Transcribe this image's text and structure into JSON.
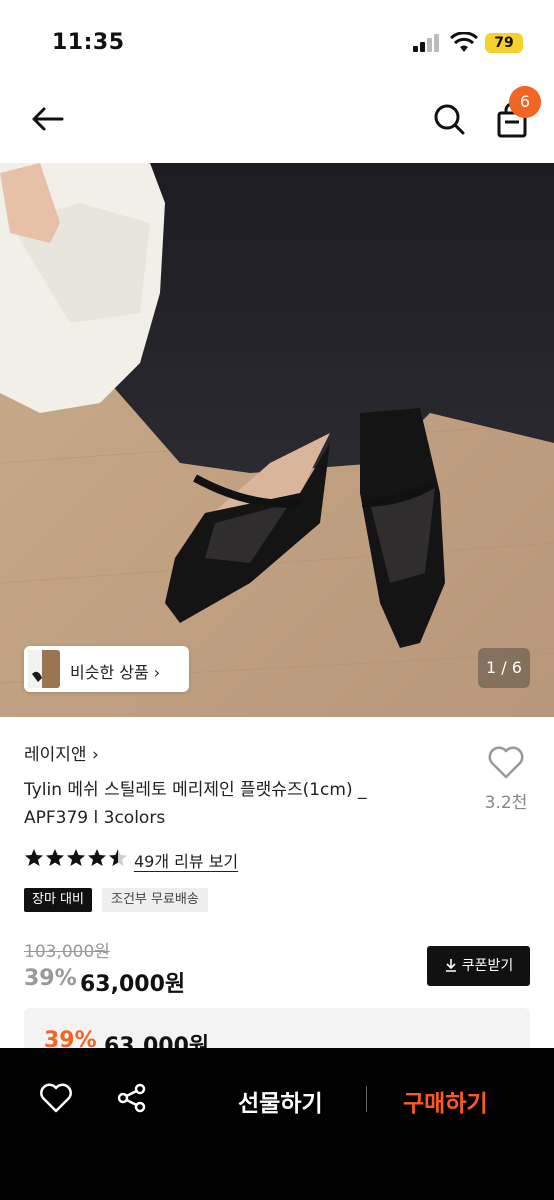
{
  "status_bar": {
    "time": "11:35",
    "battery": "79"
  },
  "header": {
    "cart_count": "6"
  },
  "gallery": {
    "similar_label": "비슷한 상품 ›",
    "page_indicator": "1 / 6"
  },
  "product": {
    "brand": "레이지앤 ›",
    "title": "Tylin 메쉬 스틸레토 메리제인 플랫슈즈(1cm) _ APF379 l 3colors",
    "wish_count": "3.2천",
    "rating": 4.5,
    "review_link": "49개 리뷰 보기",
    "tags": [
      "장마 대비",
      "조건부 무료배송"
    ],
    "original_price": "103,000원",
    "discount_rate": "39%",
    "sale_price": "63,000원",
    "coupon_label": "쿠폰받기",
    "benefit_rate": "39%",
    "benefit_price": "63,000원"
  },
  "bottom_bar": {
    "gift_label": "선물하기",
    "buy_label": "구매하기"
  },
  "colors": {
    "accent": "#f26522",
    "buy": "#ff5a1f",
    "bar_bg": "#000000"
  },
  "icons": [
    "back-arrow-icon",
    "search-icon",
    "shopping-bag-icon",
    "heart-icon",
    "share-icon",
    "download-icon",
    "star-icon"
  ]
}
